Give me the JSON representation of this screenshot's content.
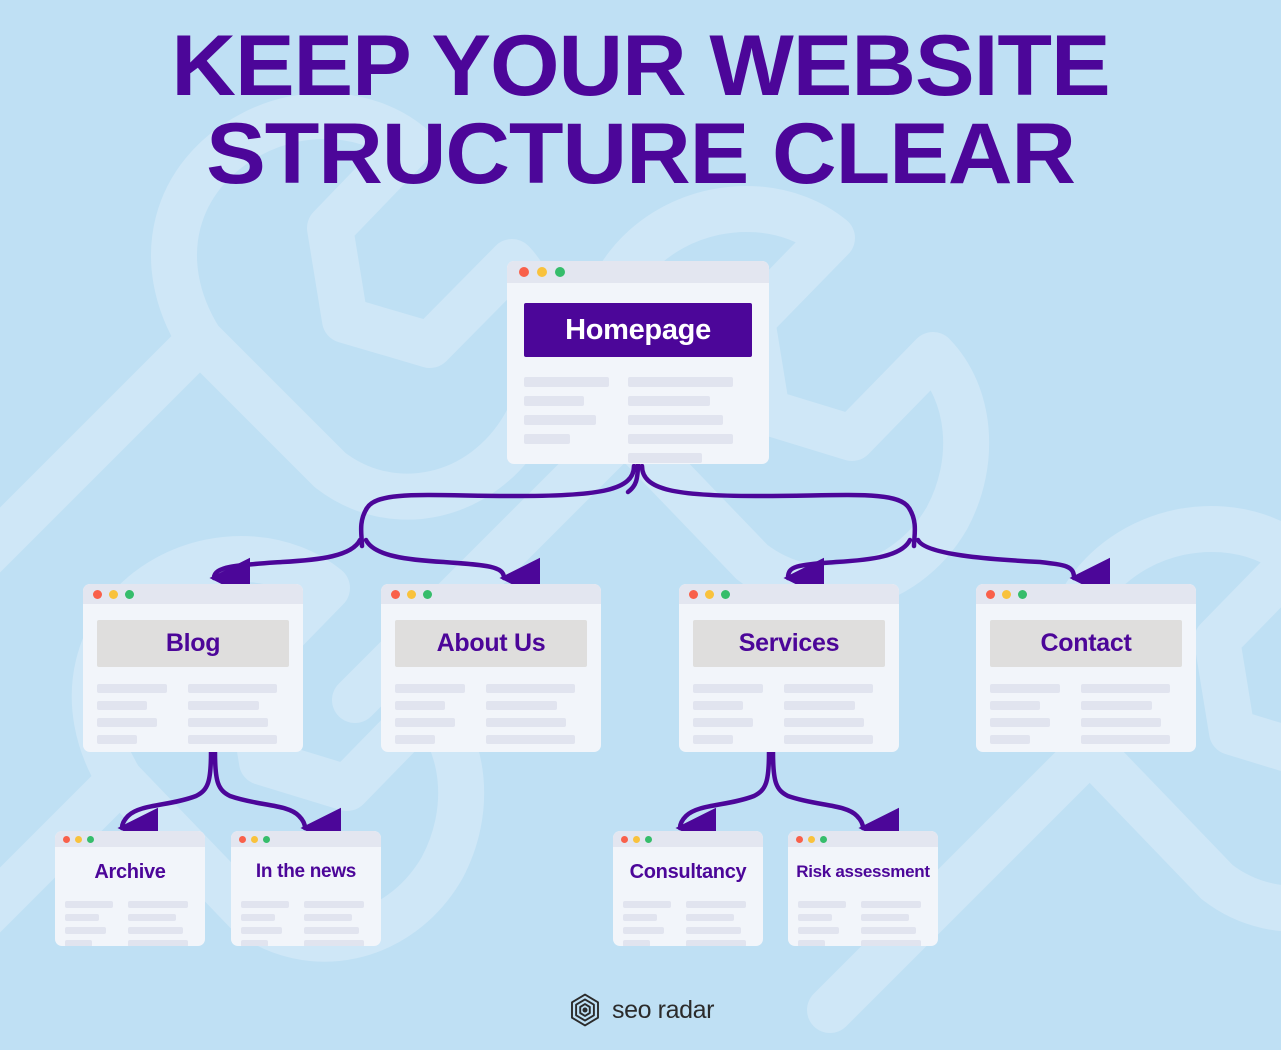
{
  "background": {
    "color": "#bfe0f4",
    "watermark_color": "#cfe7f7",
    "watermark_icon": "wrench-icon"
  },
  "heading": {
    "line1": "KEEP YOUR WEBSITE",
    "line2": "STRUCTURE CLEAR",
    "color": "#4c0699"
  },
  "colors": {
    "accent_purple": "#4c0699",
    "card_background": "#f2f5fa",
    "card_titlebar": "#e3e6f0",
    "band_gray": "#dfdedd",
    "placeholder_line": "#e1e4ef",
    "dot_red": "#f9604a",
    "dot_amber": "#f9c23c",
    "dot_green": "#36bd6b"
  },
  "window_dots": {
    "red": "traffic-light-red",
    "amber": "traffic-light-amber",
    "green": "traffic-light-green"
  },
  "tree": {
    "root": {
      "label": "Homepage",
      "level": 1,
      "band_style": "purple"
    },
    "level2": [
      {
        "label": "Blog",
        "band_style": "gray"
      },
      {
        "label": "About Us",
        "band_style": "gray"
      },
      {
        "label": "Services",
        "band_style": "gray"
      },
      {
        "label": "Contact",
        "band_style": "gray"
      }
    ],
    "level3": [
      {
        "label": "Archive",
        "band_style": "none",
        "parent": "Blog"
      },
      {
        "label": "In the news",
        "band_style": "none",
        "parent": "Blog"
      },
      {
        "label": "Consultancy",
        "band_style": "none",
        "parent": "Services"
      },
      {
        "label": "Risk assessment",
        "band_style": "none",
        "parent": "Services"
      }
    ]
  },
  "footer": {
    "brand": "seo radar",
    "logo_icon": "radar-hexagon-icon"
  }
}
